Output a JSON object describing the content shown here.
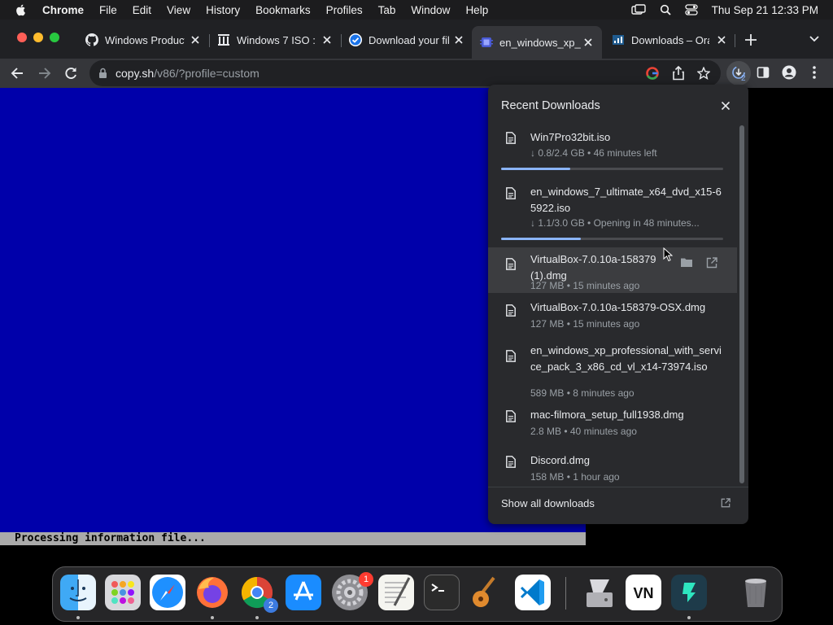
{
  "menubar": {
    "app_name": "Chrome",
    "menus": [
      "File",
      "Edit",
      "View",
      "History",
      "Bookmarks",
      "Profiles",
      "Tab",
      "Window",
      "Help"
    ],
    "datetime": "Thu Sep 21  12:33 PM",
    "icons": [
      "apple-icon",
      "screen-mirroring-icon",
      "spotlight-search-icon",
      "control-center-icon"
    ]
  },
  "tabs": [
    {
      "label": "Windows Product",
      "favicon": "github-icon",
      "active": false
    },
    {
      "label": "Windows 7 ISO :",
      "favicon": "archive-org-icon",
      "active": false
    },
    {
      "label": "Download your fil",
      "favicon": "check-circle-icon",
      "active": false
    },
    {
      "label": "en_windows_xp_",
      "favicon": "v86-icon",
      "active": true
    },
    {
      "label": "Downloads – Ora",
      "favicon": "oracle-icon",
      "active": false
    }
  ],
  "toolbar": {
    "url_host": "copy.sh",
    "url_path": "/v86/?profile=custom",
    "downloads_count": "2"
  },
  "vm": {
    "status_text": "Processing information file...",
    "screen_color": "#0000aa"
  },
  "downloads": {
    "title": "Recent Downloads",
    "items": [
      {
        "name": "Win7Pro32bit.iso",
        "status": "↓ 0.8/2.4 GB • 46 minutes left",
        "progress": 0.31
      },
      {
        "name": "en_windows_7_ultimate_x64_dvd_x15-65922.iso",
        "status": "↓ 1.1/3.0 GB • Opening in 48 minutes...",
        "progress": 0.36
      },
      {
        "name": "VirtualBox-7.0.10a-158379 (1).dmg",
        "status": "127 MB • 15 minutes ago"
      },
      {
        "name": "VirtualBox-7.0.10a-158379-OSX.dmg",
        "status": "127 MB • 15 minutes ago"
      },
      {
        "name": "en_windows_xp_professional_with_service_pack_3_x86_cd_vl_x14-73974.iso",
        "status": "589 MB • 8 minutes ago"
      },
      {
        "name": "mac-filmora_setup_full1938.dmg",
        "status": "2.8 MB • 40 minutes ago"
      },
      {
        "name": "Discord.dmg",
        "status": "158 MB • 1 hour ago"
      }
    ],
    "footer_label": "Show all downloads"
  },
  "dock": {
    "apps": [
      "finder",
      "launchpad",
      "safari",
      "firefox",
      "chrome",
      "app-store",
      "system-settings",
      "textedit",
      "terminal",
      "garageband",
      "vscode",
      "disk-utility",
      "vnc-viewer",
      "filmora",
      "trash"
    ],
    "chrome_badge": "2",
    "settings_badge": "1"
  },
  "colors": {
    "accent": "#8ab4f8",
    "vm_blue": "#0000aa",
    "panel_bg": "#292a2d"
  }
}
